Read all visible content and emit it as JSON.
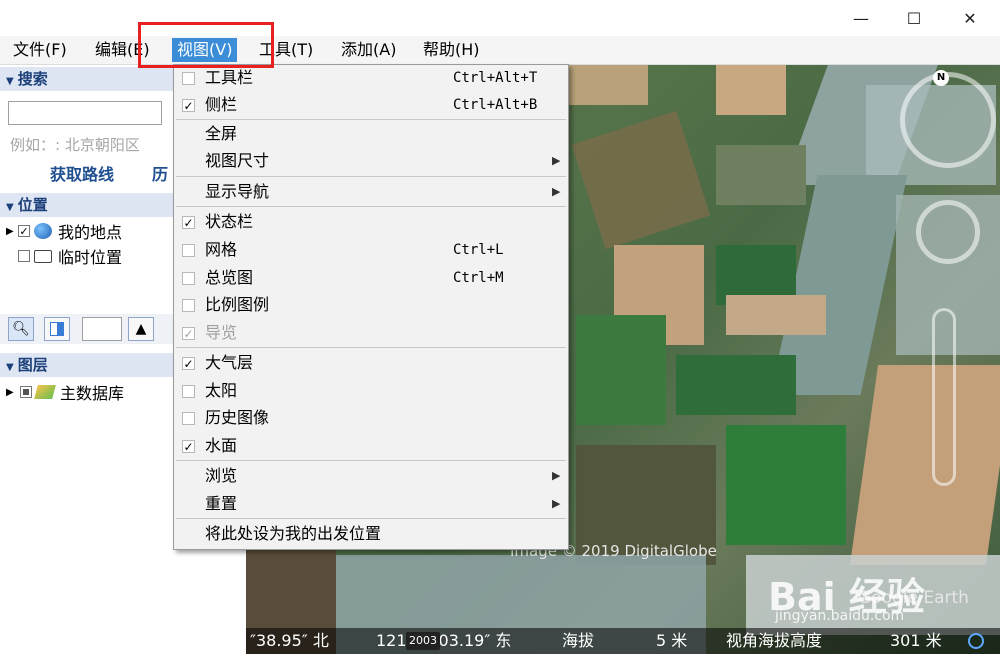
{
  "window": {
    "minimize": "—",
    "maximize": "☐",
    "close": "✕"
  },
  "menu": [
    {
      "label": "文件(F)"
    },
    {
      "label": "编辑(E)"
    },
    {
      "label": "视图(V)"
    },
    {
      "label": "工具(T)"
    },
    {
      "label": "添加(A)"
    },
    {
      "label": "帮助(H)"
    }
  ],
  "sidebar": {
    "search_title": "搜索",
    "search_value": "",
    "search_example": "例如：: 北京朝阳区",
    "get_route": "获取路线",
    "history": "历",
    "places_title": "位置",
    "places": [
      {
        "label": "我的地点",
        "checked": true
      },
      {
        "label": "临时位置",
        "checked": false
      }
    ],
    "layers_title": "图层",
    "layers": [
      {
        "label": "主数据库"
      }
    ]
  },
  "view_menu": [
    {
      "label": "工具栏",
      "shortcut": "Ctrl+Alt+T",
      "checked": false
    },
    {
      "label": "侧栏",
      "shortcut": "Ctrl+Alt+B",
      "checked": true
    },
    {
      "label": "全屏"
    },
    {
      "label": "视图尺寸",
      "submenu": true
    },
    {
      "label": "显示导航",
      "submenu": true
    },
    {
      "label": "状态栏",
      "checked": true
    },
    {
      "label": "网格",
      "shortcut": "Ctrl+L",
      "checked": false
    },
    {
      "label": "总览图",
      "shortcut": "Ctrl+M",
      "checked": false
    },
    {
      "label": "比例图例",
      "checked": false
    },
    {
      "label": "导览",
      "checked": true,
      "disabled": true
    },
    {
      "label": "大气层",
      "checked": true
    },
    {
      "label": "太阳",
      "checked": false
    },
    {
      "label": "历史图像",
      "checked": false
    },
    {
      "label": "水面",
      "checked": true
    },
    {
      "label": "浏览",
      "submenu": true
    },
    {
      "label": "重置",
      "submenu": true
    },
    {
      "label": "将此处设为我的出发位置"
    }
  ],
  "map": {
    "image_credit": "Image © 2019 DigitalGlobe",
    "google_earth": "Google Earth",
    "baidu_watermark": "Bai 经验",
    "baidu_url": "jingyan.baidu.com",
    "compass_n": "N",
    "year": "2003"
  },
  "status": {
    "lat": "″38.95″ 北",
    "lon": "121°37′03.19″ 东",
    "altitude_label": "海拔",
    "altitude_value": "5 米",
    "eye_label": "视角海拔高度",
    "eye_value": "301 米"
  }
}
